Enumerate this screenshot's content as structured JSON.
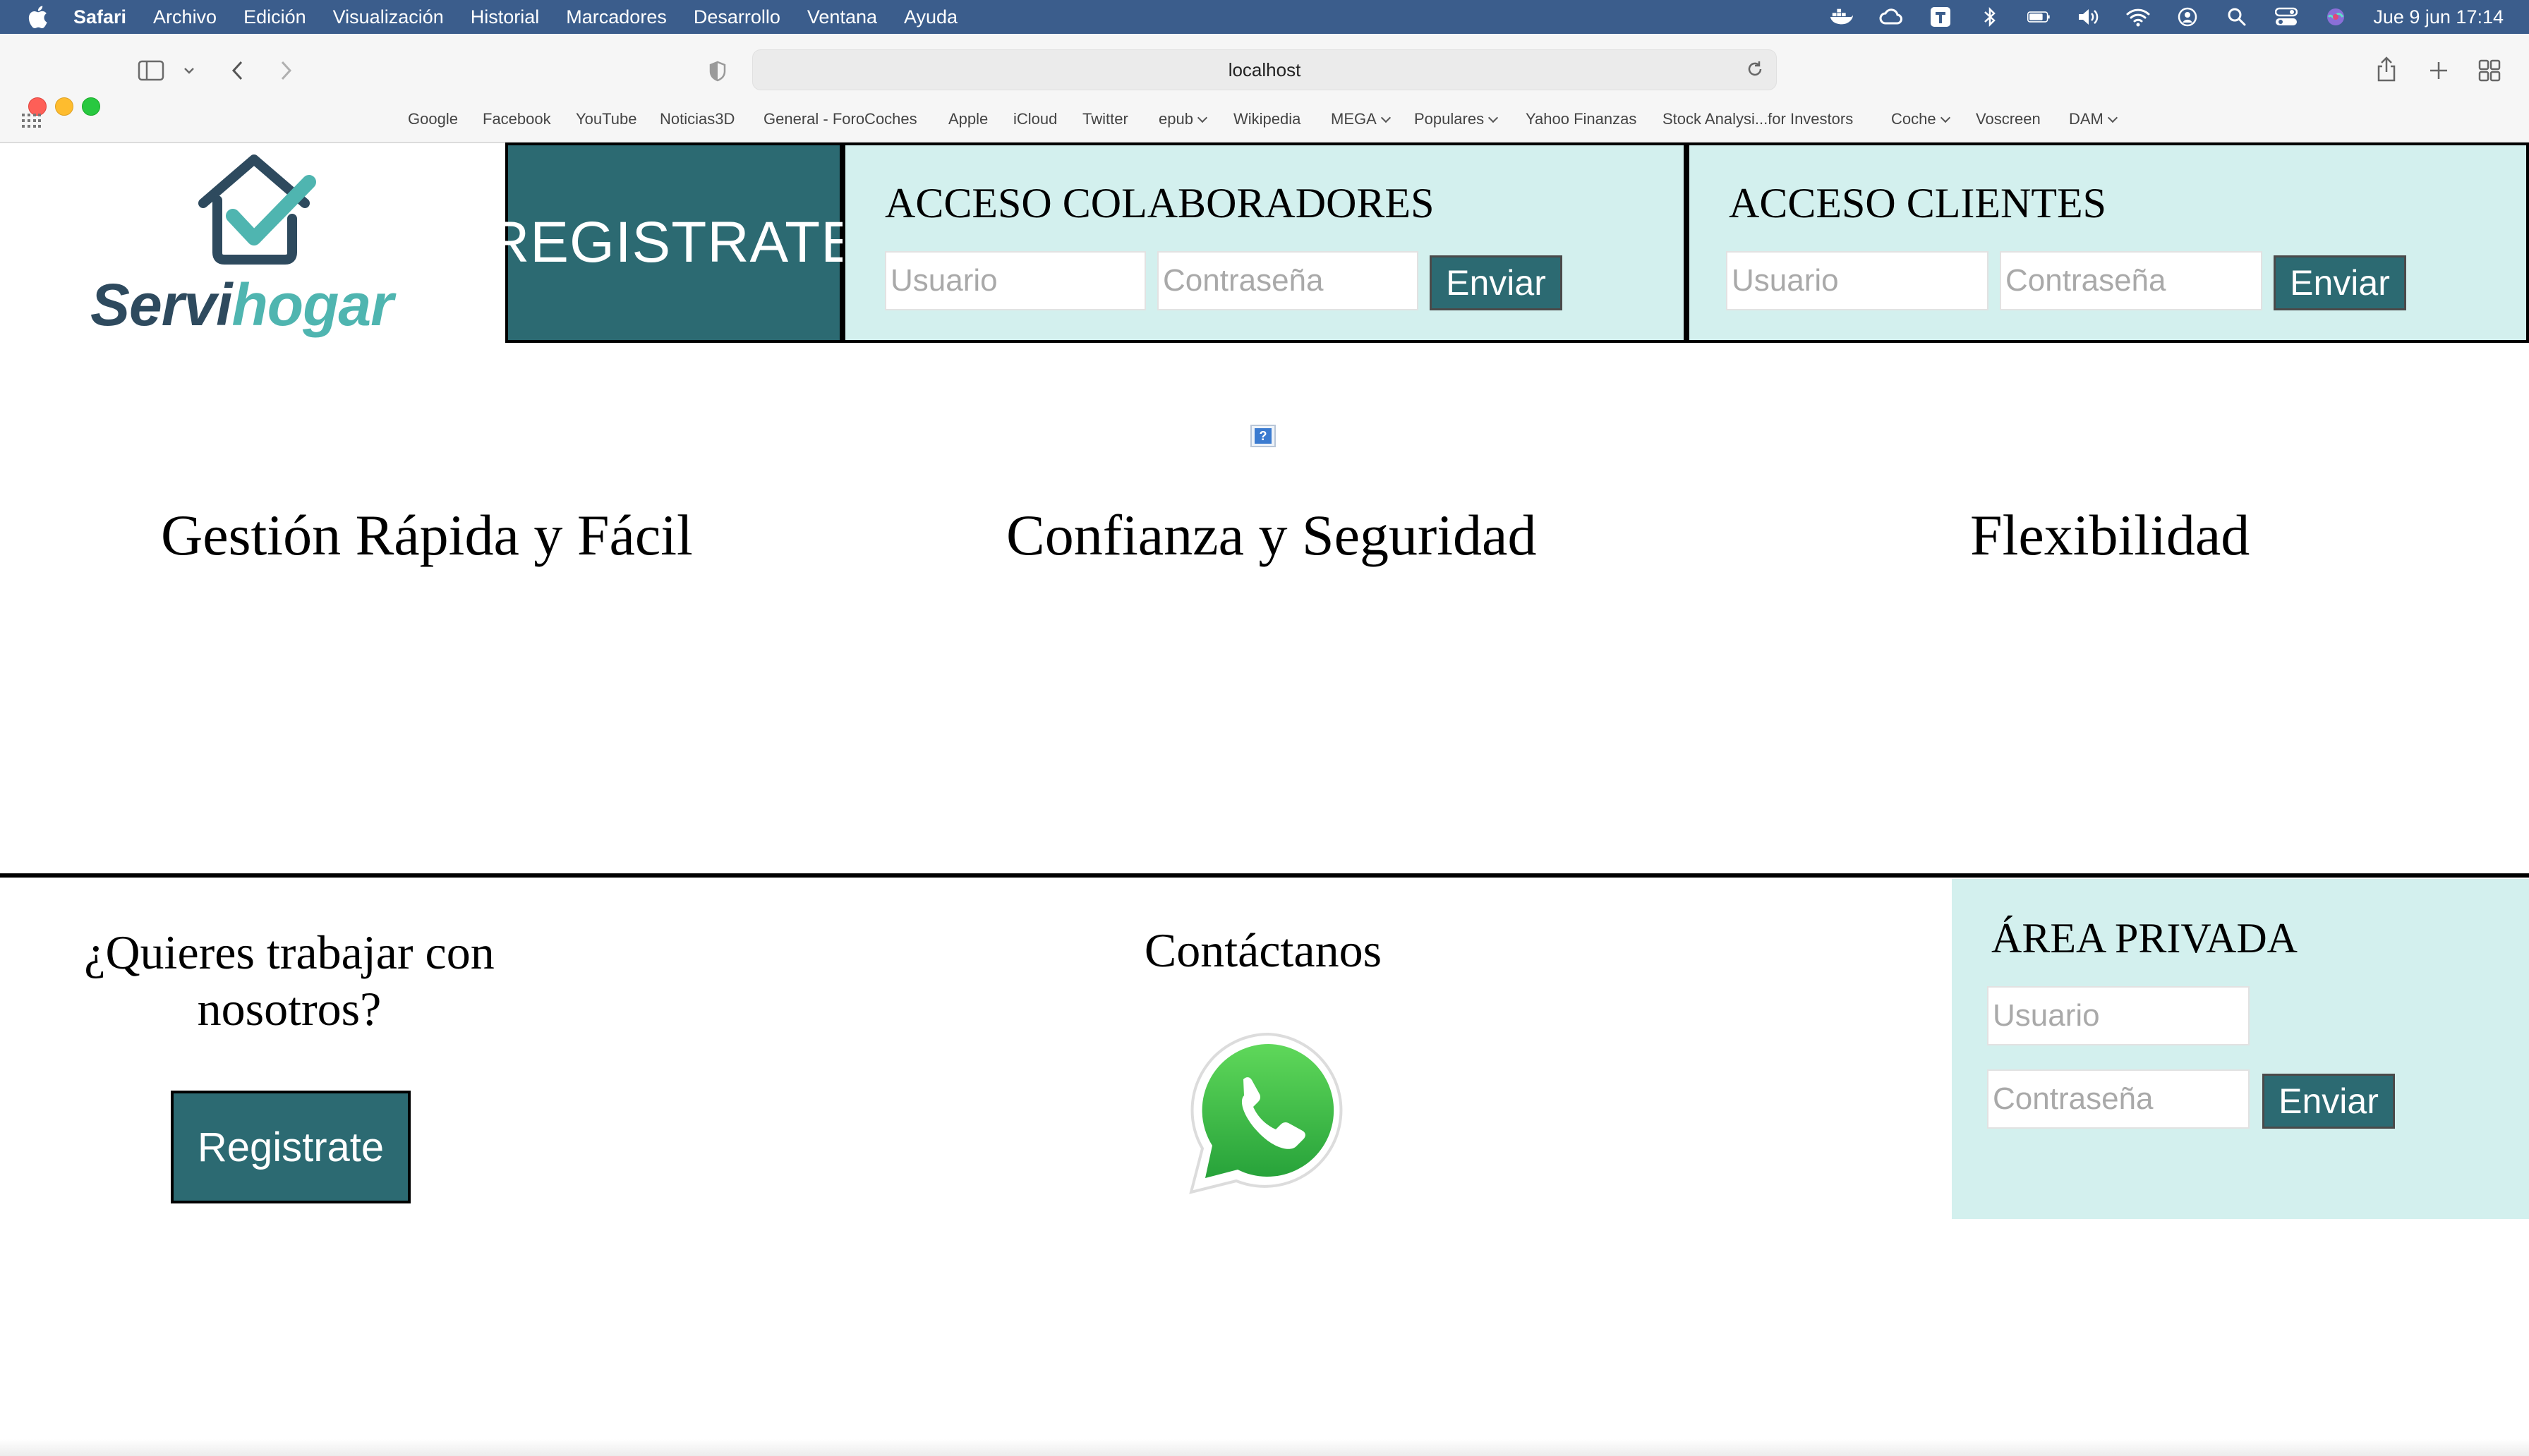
{
  "menubar": {
    "app": "Safari",
    "items": [
      "Archivo",
      "Edición",
      "Visualización",
      "Historial",
      "Marcadores",
      "Desarrollo",
      "Ventana",
      "Ayuda"
    ],
    "clock": "Jue 9 jun  17:14"
  },
  "browser": {
    "url": "localhost",
    "bookmarks": [
      "Google",
      "Facebook",
      "YouTube",
      "Noticias3D",
      "General - ForoCoches",
      "Apple",
      "iCloud",
      "Twitter",
      "epub",
      "Wikipedia",
      "MEGA",
      "Populares",
      "Yahoo Finanzas",
      "Stock Analysi...for Investors",
      "Coche",
      "Voscreen",
      "DAM"
    ]
  },
  "header": {
    "logo_text_a": "Servi",
    "logo_text_b": "hogar",
    "register_label": "REGISTRATE",
    "collaborators": {
      "title": "ACCESO COLABORADORES",
      "user_placeholder": "Usuario",
      "password_placeholder": "Contraseña",
      "submit_label": "Enviar"
    },
    "clients": {
      "title": "ACCESO CLIENTES",
      "user_placeholder": "Usuario",
      "password_placeholder": "Contraseña",
      "submit_label": "Enviar"
    }
  },
  "broken_image_glyph": "?",
  "features": [
    "Gestión Rápida y Fácil",
    "Confianza y Seguridad",
    "Flexibilidad"
  ],
  "footer": {
    "join_title": "¿Quieres trabajar con nosotros?",
    "join_button": "Registrate",
    "contact_title": "Contáctanos",
    "private": {
      "title": "ÁREA PRIVADA",
      "user_placeholder": "Usuario",
      "password_placeholder": "Contraseña",
      "submit_label": "Enviar"
    }
  },
  "colors": {
    "primary": "#2c6a72",
    "panel": "#d3f0ee",
    "menubar": "#3b5d8c",
    "logo_dark": "#2e4a5e",
    "logo_teal": "#4fb5b0"
  }
}
